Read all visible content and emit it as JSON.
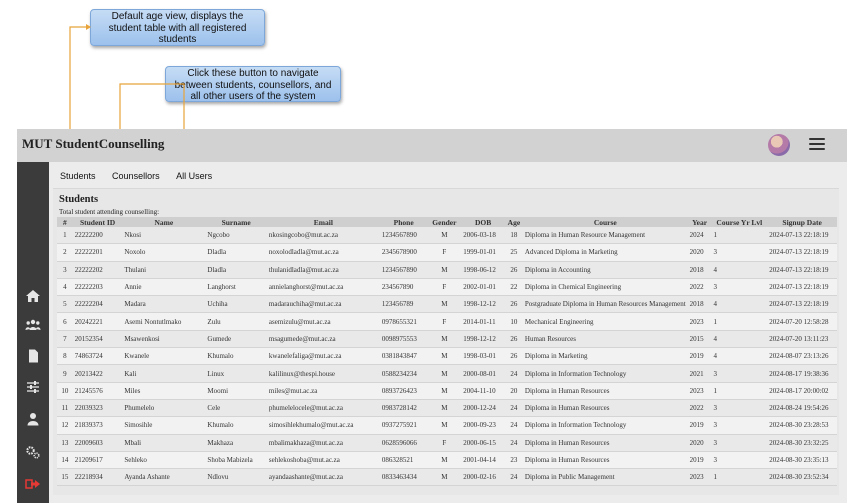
{
  "callouts": {
    "default_view": "Default age view, displays the\nstudent table with all registered\nstudents",
    "nav_buttons": "Click these button to navigate\nbetween students, counsellors, and\nall other users of the system"
  },
  "app": {
    "title": "MUT StudentCounselling"
  },
  "icons": {
    "sidebar": [
      "home-icon",
      "group-icon",
      "document-icon",
      "sliders-icon",
      "user-icon",
      "settings-icon",
      "logout-icon"
    ],
    "header": [
      "avatar",
      "hamburger-menu-icon"
    ]
  },
  "colors": {
    "sidebar": "#3b3b3b",
    "header": "#d2d2d2",
    "logout": "#e53935",
    "callout": "#aecbf0"
  },
  "nav": {
    "tabs": [
      "Students",
      "Counsellors",
      "All Users"
    ]
  },
  "students": {
    "heading": "Students",
    "total_text": "Total student attending counselling:",
    "columns": [
      "#",
      "Student ID",
      "Name",
      "Surname",
      "Email",
      "Phone",
      "Gender",
      "DOB",
      "Age",
      "Course",
      "Year",
      "Course Yr Lvl",
      "Signup Date"
    ],
    "rows": [
      [
        "1",
        "22222200",
        "Nkosi",
        "Ngcobo",
        "nkosingcobo@mut.ac.za",
        "1234567890",
        "M",
        "2006-03-18",
        "18",
        "Diploma in Human Resource Management",
        "2024",
        "1",
        "2024-07-13 22:18:19"
      ],
      [
        "2",
        "22222201",
        "Noxolo",
        "Dladla",
        "noxolodladla@mut.ac.za",
        "2345678900",
        "F",
        "1999-01-01",
        "25",
        "Advanced Diploma in Marketing",
        "2020",
        "3",
        "2024-07-13 22:18:19"
      ],
      [
        "3",
        "22222202",
        "Thulani",
        "Dladla",
        "thulanidladla@mut.ac.za",
        "1234567890",
        "M",
        "1998-06-12",
        "26",
        "Diploma in Accounting",
        "2018",
        "4",
        "2024-07-13 22:18:19"
      ],
      [
        "4",
        "22222203",
        "Annie",
        "Langhorst",
        "annielanghorst@mut.ac.za",
        "234567890",
        "F",
        "2002-01-01",
        "22",
        "Diploma in Chemical Engineering",
        "2022",
        "3",
        "2024-07-13 22:18:19"
      ],
      [
        "5",
        "22222204",
        "Madara",
        "Uchiha",
        "madarauchiha@mut.ac.za",
        "123456789",
        "M",
        "1998-12-12",
        "26",
        "Postgraduate Diploma in Human Resources Management",
        "2018",
        "4",
        "2024-07-13 22:18:19"
      ],
      [
        "6",
        "20242221",
        "Asemi Nontutlmako",
        "Zulu",
        "asemizulu@mut.ac.za",
        "0978655321",
        "F",
        "2014-01-11",
        "10",
        "Mechanical Engineering",
        "2023",
        "1",
        "2024-07-20 12:58:28"
      ],
      [
        "7",
        "20152354",
        "Msawenkosi",
        "Gumede",
        "msagumede@mut.ac.za",
        "0098975553",
        "M",
        "1998-12-12",
        "26",
        "Human Resources",
        "2015",
        "4",
        "2024-07-20 13:11:23"
      ],
      [
        "8",
        "74863724",
        "Kwanele",
        "Khumalo",
        "kwanelefaliga@mut.ac.za",
        "0381843847",
        "M",
        "1998-03-01",
        "26",
        "Diploma in Marketing",
        "2019",
        "4",
        "2024-08-07 23:13:26"
      ],
      [
        "9",
        "20213422",
        "Kali",
        "Linux",
        "kalilinux@thespi.house",
        "0588234234",
        "M",
        "2000-08-01",
        "24",
        "Diploma in Information Technology",
        "2021",
        "3",
        "2024-08-17 19:38:36"
      ],
      [
        "10",
        "21245576",
        "Miles",
        "Moomi",
        "miles@mut.ac.za",
        "0893726423",
        "M",
        "2004-11-10",
        "20",
        "Diploma in Human Resources",
        "2023",
        "1",
        "2024-08-17 20:00:02"
      ],
      [
        "11",
        "22039323",
        "Phumelelo",
        "Cele",
        "phumelelocele@mut.ac.za",
        "0983728142",
        "M",
        "2000-12-24",
        "24",
        "Diploma in Human Resources",
        "2022",
        "3",
        "2024-08-24 19:54:26"
      ],
      [
        "12",
        "21839373",
        "Simosihle",
        "Khumalo",
        "simosihlekhumalo@mut.ac.za",
        "0937275921",
        "M",
        "2000-09-23",
        "24",
        "Diploma in Information Technology",
        "2019",
        "3",
        "2024-08-30 23:28:53"
      ],
      [
        "13",
        "22009603",
        "Mbali",
        "Makhaza",
        "mbalimakhaza@mut.ac.za",
        "0628596066",
        "F",
        "2000-06-15",
        "24",
        "Diploma in Human Resources",
        "2020",
        "3",
        "2024-08-30 23:32:25"
      ],
      [
        "14",
        "21209617",
        "Sehleko",
        "Shoba Mabizela",
        "sehlekoshoba@mut.ac.za",
        "086328521",
        "M",
        "2001-04-14",
        "23",
        "Diploma in Human Resources",
        "2019",
        "3",
        "2024-08-30 23:35:13"
      ],
      [
        "15",
        "22218934",
        "Ayanda Ashante",
        "Ndlovu",
        "ayandaashante@mut.ac.za",
        "0833463434",
        "M",
        "2000-02-16",
        "24",
        "Diploma in Public Management",
        "2023",
        "1",
        "2024-08-30 23:52:34"
      ]
    ]
  }
}
